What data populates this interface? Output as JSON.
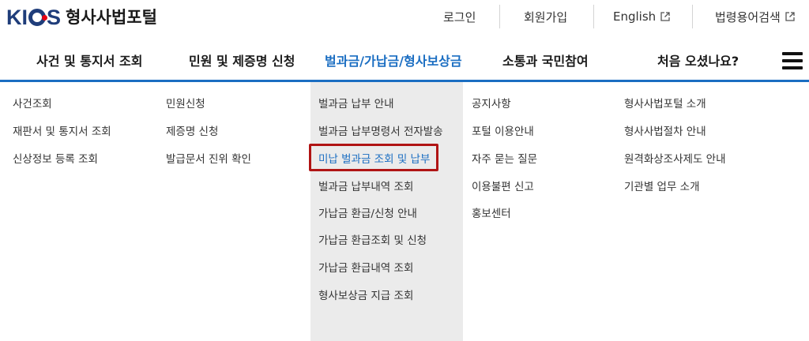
{
  "header": {
    "logo_text": "KICS",
    "site_title": "형사사법포털",
    "utilities": [
      {
        "label": "로그인"
      },
      {
        "label": "회원가입"
      },
      {
        "label": "English",
        "icon": "external-link-icon"
      },
      {
        "label": "법령용어검색",
        "icon": "external-link-icon"
      }
    ]
  },
  "gnb": {
    "items": [
      {
        "label": "사건 및 통지서 조회"
      },
      {
        "label": "민원 및 제증명 신청"
      },
      {
        "label": "벌과금/가납금/형사보상금"
      },
      {
        "label": "소통과 국민참여"
      },
      {
        "label": "처음 오셨나요?"
      }
    ],
    "active_index": 2
  },
  "dropdown": {
    "columns": [
      {
        "items": [
          "사건조회",
          "재판서 및 통지서 조회",
          "신상정보 등록 조회"
        ]
      },
      {
        "items": [
          "민원신청",
          "제증명 신청",
          "발급문서 진위 확인"
        ]
      },
      {
        "items": [
          "벌과금 납부 안내",
          "벌과금 납부명령서 전자발송",
          "미납 벌과금 조회 및 납부",
          "벌과금 납부내역 조회",
          "가납금 환급/신청 안내",
          "가납금 환급조회 및 신청",
          "가납금 환급내역 조회",
          "형사보상금 지급 조회"
        ]
      },
      {
        "items": [
          "공지사항",
          "포털 이용안내",
          "자주 묻는 질문",
          "이용불편 신고",
          "홍보센터"
        ]
      },
      {
        "items": [
          "형사사법포털 소개",
          "형사사법절차 안내",
          "원격화상조사제도 안내",
          "기관별 업무 소개"
        ]
      }
    ],
    "highlighted": "미납 벌과금 조회 및 납부"
  },
  "colors": {
    "accent": "#1b6ec2",
    "highlight_border": "#b01414",
    "active_column_bg": "#ebebeb",
    "logo": "#1f3d7a"
  }
}
